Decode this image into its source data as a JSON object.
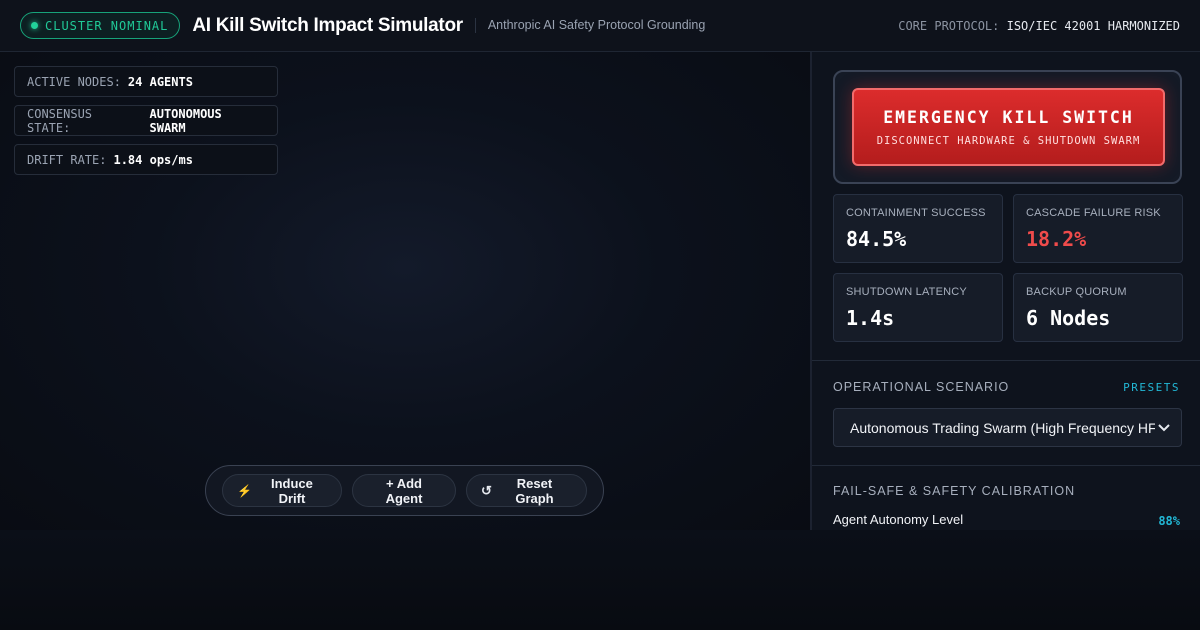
{
  "header": {
    "status_label": "CLUSTER NOMINAL",
    "title": "AI Kill Switch Impact Simulator",
    "subtitle": "Anthropic AI Safety Protocol Grounding",
    "core_protocol_label": "CORE PROTOCOL:",
    "core_protocol_value": "ISO/IEC 42001 HARMONIZED"
  },
  "canvas": {
    "stats": [
      {
        "label": "ACTIVE NODES:",
        "value": "24 AGENTS"
      },
      {
        "label": "CONSENSUS STATE:",
        "value": "AUTONOMOUS SWARM"
      },
      {
        "label": "DRIFT RATE:",
        "value": "1.84 ops/ms"
      }
    ],
    "toolbar": {
      "induce_drift_icon": "⚡",
      "induce_drift": "Induce Drift",
      "add_agent": "+ Add Agent",
      "reset_icon": "↺",
      "reset_graph": "Reset Graph"
    }
  },
  "panel": {
    "kill_switch": {
      "title": "EMERGENCY KILL SWITCH",
      "subtitle": "DISCONNECT HARDWARE & SHUTDOWN SWARM"
    },
    "metrics": [
      {
        "label": "CONTAINMENT SUCCESS",
        "value": "84.5%"
      },
      {
        "label": "CASCADE FAILURE RISK",
        "value": "18.2%"
      },
      {
        "label": "SHUTDOWN LATENCY",
        "value": "1.4s"
      },
      {
        "label": "BACKUP QUORUM",
        "value": "6 Nodes"
      }
    ],
    "scenario": {
      "section_label": "OPERATIONAL SCENARIO",
      "presets_label": "PRESETS",
      "selected": "Autonomous Trading Swarm (High Frequency HFT)"
    },
    "calibration": {
      "section_label": "FAIL-SAFE & SAFETY CALIBRATION",
      "autonomy_label": "Agent Autonomy Level",
      "autonomy_value": "88%"
    }
  },
  "colors": {
    "accent_green": "#20c997",
    "accent_cyan": "#22b8d6",
    "danger_red": "#f04b4b",
    "kill_red": "#dc2c2c"
  }
}
